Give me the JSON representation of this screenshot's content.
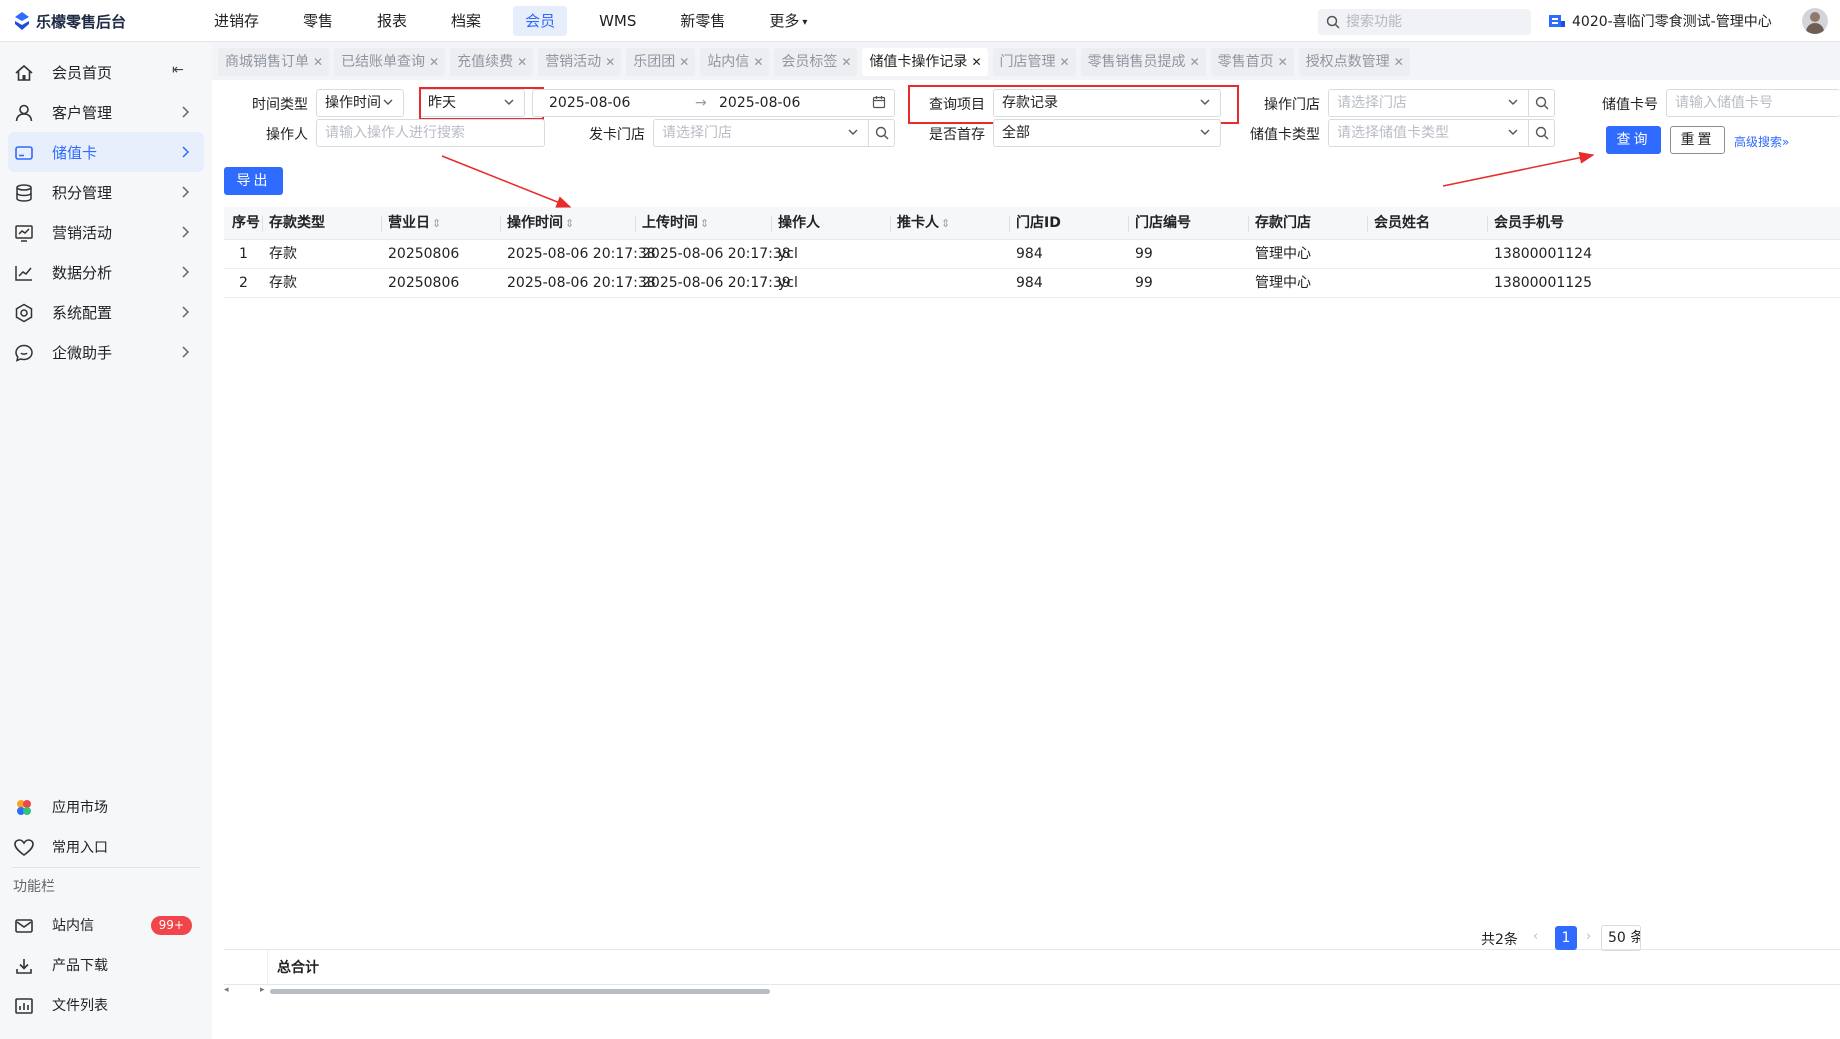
{
  "app": {
    "title": "乐檬零售后台"
  },
  "topnav": {
    "items": [
      "进销存",
      "零售",
      "报表",
      "档案",
      "会员",
      "WMS",
      "新零售",
      "更多"
    ],
    "active_index": 4
  },
  "header": {
    "search_placeholder": "搜索功能",
    "store": "4020-喜临门零食测试-管理中心"
  },
  "sidebar": {
    "items": [
      {
        "label": "会员首页",
        "icon": "home-icon"
      },
      {
        "label": "客户管理",
        "icon": "user-icon"
      },
      {
        "label": "储值卡",
        "icon": "card-icon"
      },
      {
        "label": "积分管理",
        "icon": "database-icon"
      },
      {
        "label": "营销活动",
        "icon": "chart-board-icon"
      },
      {
        "label": "数据分析",
        "icon": "line-chart-icon"
      },
      {
        "label": "系统配置",
        "icon": "settings-icon"
      },
      {
        "label": "企微助手",
        "icon": "chat-icon"
      }
    ],
    "active_index": 2,
    "bottom": {
      "app_market": "应用市场",
      "favorites": "常用入口",
      "section_title": "功能栏",
      "inbox": "站内信",
      "inbox_badge": "99+",
      "product_download": "产品下载",
      "file_list": "文件列表"
    }
  },
  "tabs": {
    "items": [
      "商城销售订单",
      "已结账单查询",
      "充值续费",
      "营销活动",
      "乐团团",
      "站内信",
      "会员标签",
      "储值卡操作记录",
      "门店管理",
      "零售销售员提成",
      "零售首页",
      "授权点数管理"
    ],
    "active_index": 7
  },
  "filters": {
    "time_type_label": "时间类型",
    "time_type_value": "操作时间",
    "date_preset": "昨天",
    "date_start": "2025-08-06",
    "date_end": "2025-08-06",
    "query_item_label": "查询项目",
    "query_item_value": "存款记录",
    "op_store_label": "操作门店",
    "op_store_placeholder": "请选择门店",
    "card_no_label": "储值卡号",
    "card_no_placeholder": "请输入储值卡号",
    "operator_label": "操作人",
    "operator_placeholder": "请输入操作人进行搜索",
    "issue_store_label": "发卡门店",
    "issue_store_placeholder": "请选择门店",
    "first_deposit_label": "是否首存",
    "first_deposit_value": "全部",
    "card_type_label": "储值卡类型",
    "card_type_placeholder": "请选择储值卡类型",
    "query_button": "查询",
    "reset_button": "重置",
    "advanced_search": "高级搜索",
    "export_button": "导出"
  },
  "table": {
    "columns": [
      "序号",
      "存款类型",
      "营业日",
      "操作时间",
      "上传时间",
      "操作人",
      "推卡人",
      "门店ID",
      "门店编号",
      "存款门店",
      "会员姓名",
      "会员手机号"
    ],
    "sortable": [
      false,
      false,
      true,
      true,
      true,
      false,
      true,
      false,
      false,
      false,
      false,
      false
    ],
    "rows": [
      [
        "1",
        "存款",
        "20250806",
        "2025-08-06 20:17:38",
        "2025-08-06 20:17:38",
        "ycl",
        "",
        "984",
        "99",
        "管理中心",
        "",
        "13800001124"
      ],
      [
        "2",
        "存款",
        "20250806",
        "2025-08-06 20:17:38",
        "2025-08-06 20:17:39",
        "ycl",
        "",
        "984",
        "99",
        "管理中心",
        "",
        "13800001125"
      ]
    ],
    "footer_label": "总合计"
  },
  "pagination": {
    "total_text": "共2条",
    "current_page": "1",
    "page_size": "50 条"
  },
  "colors": {
    "accent": "#2f6bff",
    "annotation_red": "#e82b2b",
    "badge_red": "#f0454a"
  }
}
